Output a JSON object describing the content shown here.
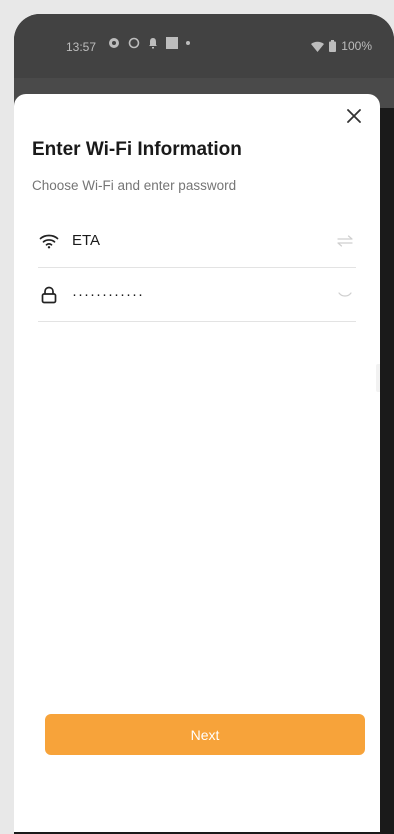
{
  "status_bar": {
    "time": "13:57",
    "battery": "100%"
  },
  "dialog": {
    "title": "Enter Wi-Fi Information",
    "subtitle": "Choose Wi-Fi and enter password",
    "wifi_field": {
      "icon": "wifi-icon",
      "value": "ETA",
      "action_icon": "swap-icon"
    },
    "password_field": {
      "icon": "lock-icon",
      "value": "············",
      "action_icon": "eye-closed-icon"
    },
    "next_label": "Next"
  },
  "colors": {
    "accent": "#f7a33a",
    "status_bar": "#424242",
    "sheet": "#ffffff"
  }
}
